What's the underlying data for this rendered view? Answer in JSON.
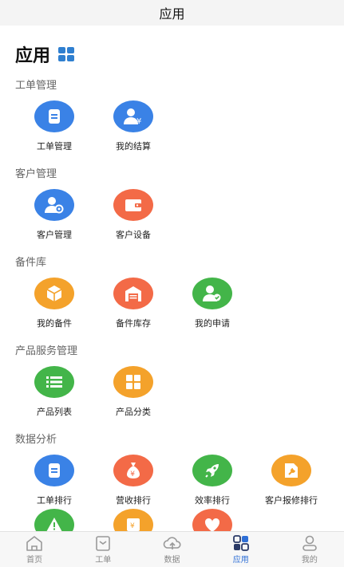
{
  "topbar": {
    "title": "应用"
  },
  "heading": {
    "title": "应用",
    "icon": "grid-icon"
  },
  "sections": [
    {
      "title": "工单管理",
      "items": [
        {
          "label": "工单管理",
          "icon": "document-icon",
          "color": "#3a82e6"
        },
        {
          "label": "我的结算",
          "icon": "user-yen-icon",
          "color": "#3a82e6"
        }
      ]
    },
    {
      "title": "客户管理",
      "items": [
        {
          "label": "客户管理",
          "icon": "user-settings-icon",
          "color": "#3a82e6"
        },
        {
          "label": "客户设备",
          "icon": "wallet-icon",
          "color": "#f36a47"
        }
      ]
    },
    {
      "title": "备件库",
      "items": [
        {
          "label": "我的备件",
          "icon": "box-icon",
          "color": "#f4a22b"
        },
        {
          "label": "备件库存",
          "icon": "warehouse-icon",
          "color": "#f36a47"
        },
        {
          "label": "我的申请",
          "icon": "user-check-icon",
          "color": "#43b549"
        }
      ]
    },
    {
      "title": "产品服务管理",
      "items": [
        {
          "label": "产品列表",
          "icon": "list-icon",
          "color": "#43b549"
        },
        {
          "label": "产品分类",
          "icon": "category-grid-icon",
          "color": "#f4a22b"
        }
      ]
    },
    {
      "title": "数据分析",
      "items": [
        {
          "label": "工单排行",
          "icon": "document-icon",
          "color": "#3a82e6"
        },
        {
          "label": "营收排行",
          "icon": "money-bag-icon",
          "color": "#f36a47"
        },
        {
          "label": "效率排行",
          "icon": "rocket-icon",
          "color": "#43b549"
        },
        {
          "label": "客户报修排行",
          "icon": "wrench-report-icon",
          "color": "#f4a22b"
        }
      ]
    }
  ],
  "partial_row": [
    {
      "icon": "warning-icon",
      "color": "#43b549"
    },
    {
      "icon": "yen-bill-icon",
      "color": "#f4a22b"
    },
    {
      "icon": "heart-icon",
      "color": "#f36a47"
    }
  ],
  "tabbar": {
    "tabs": [
      {
        "label": "首页",
        "icon": "home-icon"
      },
      {
        "label": "工单",
        "icon": "clipboard-icon"
      },
      {
        "label": "数据",
        "icon": "cloud-upload-icon"
      },
      {
        "label": "应用",
        "icon": "apps-icon",
        "active": true
      },
      {
        "label": "我的",
        "icon": "profile-icon"
      }
    ]
  },
  "colors": {
    "accent": "#2f6fd6",
    "blue": "#3a82e6",
    "orange": "#f36a47",
    "yellow": "#f4a22b",
    "green": "#43b549"
  }
}
